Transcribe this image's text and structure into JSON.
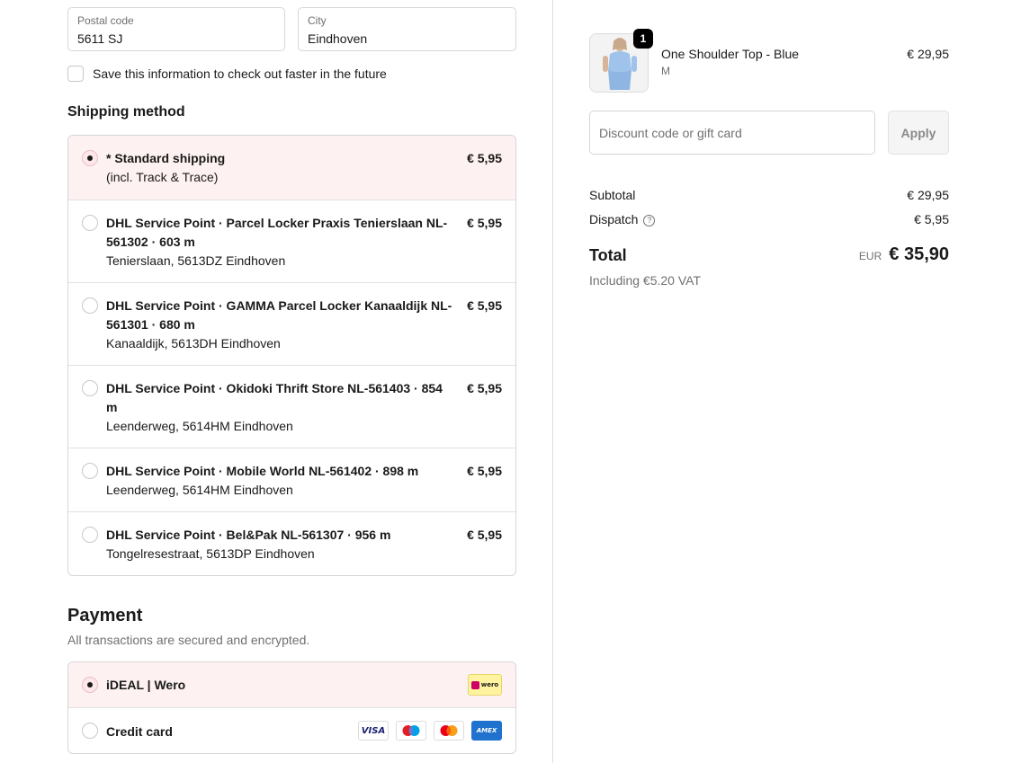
{
  "address": {
    "postal_label": "Postal code",
    "postal_value": "5611 SJ",
    "city_label": "City",
    "city_value": "Eindhoven",
    "save_info": "Save this information to check out faster in the future"
  },
  "shipping": {
    "heading": "Shipping method",
    "options": [
      {
        "title": "* Standard shipping",
        "sub": "(incl. Track & Trace)",
        "price": "€ 5,95",
        "selected": true
      },
      {
        "title": "DHL Service Point · Parcel Locker Praxis Tenierslaan NL-561302 · 603 m",
        "sub": "Tenierslaan, 5613DZ Eindhoven",
        "price": "€ 5,95",
        "selected": false
      },
      {
        "title": "DHL Service Point · GAMMA Parcel Locker Kanaaldijk NL-561301 · 680 m",
        "sub": "Kanaaldijk, 5613DH Eindhoven",
        "price": "€ 5,95",
        "selected": false
      },
      {
        "title": "DHL Service Point · Okidoki Thrift Store NL-561403 · 854 m",
        "sub": "Leenderweg, 5614HM Eindhoven",
        "price": "€ 5,95",
        "selected": false
      },
      {
        "title": "DHL Service Point · Mobile World NL-561402 · 898 m",
        "sub": "Leenderweg, 5614HM Eindhoven",
        "price": "€ 5,95",
        "selected": false
      },
      {
        "title": "DHL Service Point · Bel&Pak NL-561307 · 956 m",
        "sub": "Tongelresestraat, 5613DP Eindhoven",
        "price": "€ 5,95",
        "selected": false
      }
    ]
  },
  "payment": {
    "heading": "Payment",
    "subtitle": "All transactions are secured and encrypted.",
    "options": [
      {
        "title": "iDEAL | Wero",
        "selected": true
      },
      {
        "title": "Credit card",
        "selected": false
      }
    ],
    "wero_label": "wero",
    "visa_label": "VISA",
    "amex_label": "AMEX"
  },
  "cart": {
    "quantity": "1",
    "product_name": "One Shoulder Top - Blue",
    "variant": "M",
    "price": "€ 29,95",
    "discount_placeholder": "Discount code or gift card",
    "apply_label": "Apply"
  },
  "summary": {
    "subtotal_label": "Subtotal",
    "subtotal_value": "€ 29,95",
    "dispatch_label": "Dispatch",
    "dispatch_value": "€ 5,95",
    "total_label": "Total",
    "currency": "EUR",
    "total_value": "€ 35,90",
    "vat_note": "Including €5.20 VAT"
  },
  "colors": {
    "selected_bg": "#fef1f1",
    "border": "#d6d6d6",
    "muted_text": "#707070"
  }
}
